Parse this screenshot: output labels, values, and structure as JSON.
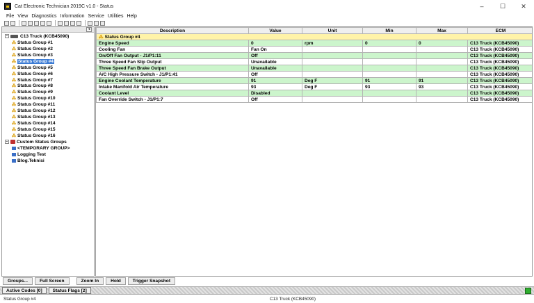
{
  "window": {
    "title": "Cat Electronic Technician 2019C v1.0 - Status",
    "minimize": "–",
    "maximize": "☐",
    "close": "✕"
  },
  "menu": [
    "File",
    "View",
    "Diagnostics",
    "Information",
    "Service",
    "Utilities",
    "Help"
  ],
  "tree": {
    "collapse_glyph": "◂",
    "root": "C13 Truck (KCB45090)",
    "groups": [
      "Status Group #1",
      "Status Group #2",
      "Status Group #3",
      "Status Group #4",
      "Status Group #5",
      "Status Group #6",
      "Status Group #7",
      "Status Group #8",
      "Status Group #9",
      "Status Group #10",
      "Status Group #11",
      "Status Group #12",
      "Status Group #13",
      "Status Group #14",
      "Status Group #15",
      "Status Group #16"
    ],
    "selected_index": 3,
    "custom_root": "Custom Status Groups",
    "custom_items": [
      "<TEMPORARY GROUP>",
      "Logging Test",
      "Blog.Teknisi"
    ]
  },
  "table": {
    "headers": [
      "Description",
      "Value",
      "Unit",
      "Min",
      "Max",
      "ECM"
    ],
    "group_label": "Status Group #4",
    "rows": [
      {
        "description": "Engine Speed",
        "value": "0",
        "unit": "rpm",
        "min": "0",
        "max": "0",
        "ecm": "C13 Truck (KCB45090)",
        "shade": "green"
      },
      {
        "description": "Cooling Fan",
        "value": "Fan On",
        "unit": "",
        "min": "",
        "max": "",
        "ecm": "C13 Truck (KCB45090)",
        "shade": "white"
      },
      {
        "description": "On/Off Fan Output - J1/P1:11",
        "value": "Off",
        "unit": "",
        "min": "",
        "max": "",
        "ecm": "C13 Truck (KCB45090)",
        "shade": "green"
      },
      {
        "description": "Three Speed Fan Slip Output",
        "value": "Unavailable",
        "unit": "",
        "min": "",
        "max": "",
        "ecm": "C13 Truck (KCB45090)",
        "shade": "white"
      },
      {
        "description": "Three Speed Fan Brake Output",
        "value": "Unavailable",
        "unit": "",
        "min": "",
        "max": "",
        "ecm": "C13 Truck (KCB45090)",
        "shade": "green"
      },
      {
        "description": "A/C High Pressure Switch - J1/P1:41",
        "value": "Off",
        "unit": "",
        "min": "",
        "max": "",
        "ecm": "C13 Truck (KCB45090)",
        "shade": "white"
      },
      {
        "description": "Engine Coolant Temperature",
        "value": "91",
        "unit": "Deg F",
        "min": "91",
        "max": "91",
        "ecm": "C13 Truck (KCB45090)",
        "shade": "green"
      },
      {
        "description": "Intake Manifold Air Temperature",
        "value": "93",
        "unit": "Deg F",
        "min": "93",
        "max": "93",
        "ecm": "C13 Truck (KCB45090)",
        "shade": "white"
      },
      {
        "description": "Coolant Level",
        "value": "Disabled",
        "unit": "",
        "min": "",
        "max": "",
        "ecm": "C13 Truck (KCB45090)",
        "shade": "green"
      },
      {
        "description": "Fan Override Switch - J1/P1:7",
        "value": "Off",
        "unit": "",
        "min": "",
        "max": "",
        "ecm": "C13 Truck (KCB45090)",
        "shade": "white"
      }
    ]
  },
  "buttons": {
    "groups": "Groups...",
    "full_screen": "Full Screen",
    "zoom_in": "Zoom In",
    "hold": "Hold",
    "trigger_snapshot": "Trigger Snapshot"
  },
  "tabs": {
    "active_codes": "Active Codes [0]",
    "status_flags": "Status Flags [2]"
  },
  "statusbar": {
    "left": "Status Group #4",
    "center": "C13 Truck (KCB45090)"
  },
  "colors": {
    "row_green": "#ccf5cc",
    "group_row": "#fff3a8",
    "selection": "#3b7bd4",
    "connection": "#2fae2f"
  }
}
